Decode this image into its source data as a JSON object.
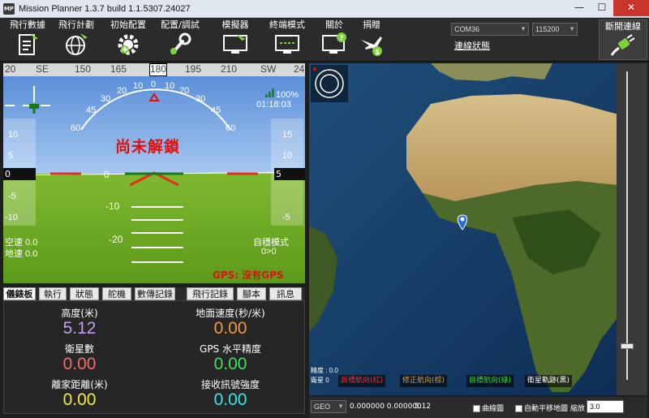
{
  "app": {
    "title": "Mission Planner 1.3.7 build 1.1.5307.24027",
    "icon_text": "MP"
  },
  "window": {
    "minimize": "—",
    "maximize": "☐",
    "close": "✕"
  },
  "toolbar": {
    "buttons": [
      {
        "label": "飛行數據",
        "icon": "flight-data-icon"
      },
      {
        "label": "飛行計劃",
        "icon": "flight-plan-icon"
      },
      {
        "label": "初始配置",
        "icon": "initial-setup-icon"
      },
      {
        "label": "配置/調試",
        "icon": "config-tuning-icon"
      },
      {
        "label": "模擬器",
        "icon": "simulator-icon"
      },
      {
        "label": "終端模式",
        "icon": "terminal-icon"
      },
      {
        "label": "關於",
        "icon": "help-icon"
      },
      {
        "label": "捐贈",
        "icon": "donate-icon"
      }
    ],
    "port": "COM36",
    "baud": "115200",
    "link_stats": "連線狀態",
    "disconnect": "斷開連線"
  },
  "compass": {
    "ticks": [
      "20",
      "SE",
      "150",
      "165",
      "180",
      "195",
      "210",
      "SW",
      "24"
    ]
  },
  "hud": {
    "armed_status": "尚未解鎖",
    "battery": "100%",
    "timer": "01:18:03",
    "roll_scale": [
      "60",
      "45",
      "30",
      "20",
      "10",
      "0",
      "10",
      "20",
      "30",
      "45",
      "60"
    ],
    "pitch_labels": [
      "0",
      "-10",
      "-20"
    ],
    "speed_ticks": [
      "10",
      "5",
      "-5",
      "-10"
    ],
    "speed_value": "0",
    "alt_ticks": [
      "15",
      "10",
      "-5"
    ],
    "alt_value": "5",
    "airspeed": "空速 0.0",
    "groundspeed": "地速 0.0",
    "flight_mode": "自穩模式",
    "wp_dist": "0>0",
    "gps_status": "GPS: 沒有GPS"
  },
  "tabs": [
    "儀錶板",
    "執行",
    "狀態",
    "舵機",
    "數傳記錄",
    "飛行記錄",
    "腳本",
    "訊息"
  ],
  "quick": {
    "items": [
      {
        "label": "高度(米)",
        "value": "5.12",
        "color": "#c79cf0"
      },
      {
        "label": "地面速度(秒/米)",
        "value": "0.00",
        "color": "#f29a37"
      },
      {
        "label": "衛星數",
        "value": "0.00",
        "color": "#f26b6b"
      },
      {
        "label": "GPS 水平精度",
        "value": "0.00",
        "color": "#3fe05c"
      },
      {
        "label": "離家距離(米)",
        "value": "0.00",
        "color": "#f3ee37"
      },
      {
        "label": "接收訊號強度",
        "value": "0.00",
        "color": "#33e8e8"
      }
    ]
  },
  "map": {
    "status_small": "精度 : 0.0",
    "sat_small": "衛星 0",
    "legend": [
      {
        "label": "目標航向(紅)",
        "color": "#ff3030"
      },
      {
        "label": "修正航向(棕)",
        "color": "#e0a040"
      },
      {
        "label": "目標航向(綠)",
        "color": "#30e030"
      },
      {
        "label": "衛星軌跡(黑)",
        "color": "#ffffff"
      }
    ],
    "coord_system": "GEO",
    "coords": "0.000000 0.000000",
    "altitude": "5.12",
    "graph_label": "曲線圖",
    "autopan_label": "自動平移地圖",
    "zoom_label": "縮放",
    "zoom_value": "3.0"
  }
}
